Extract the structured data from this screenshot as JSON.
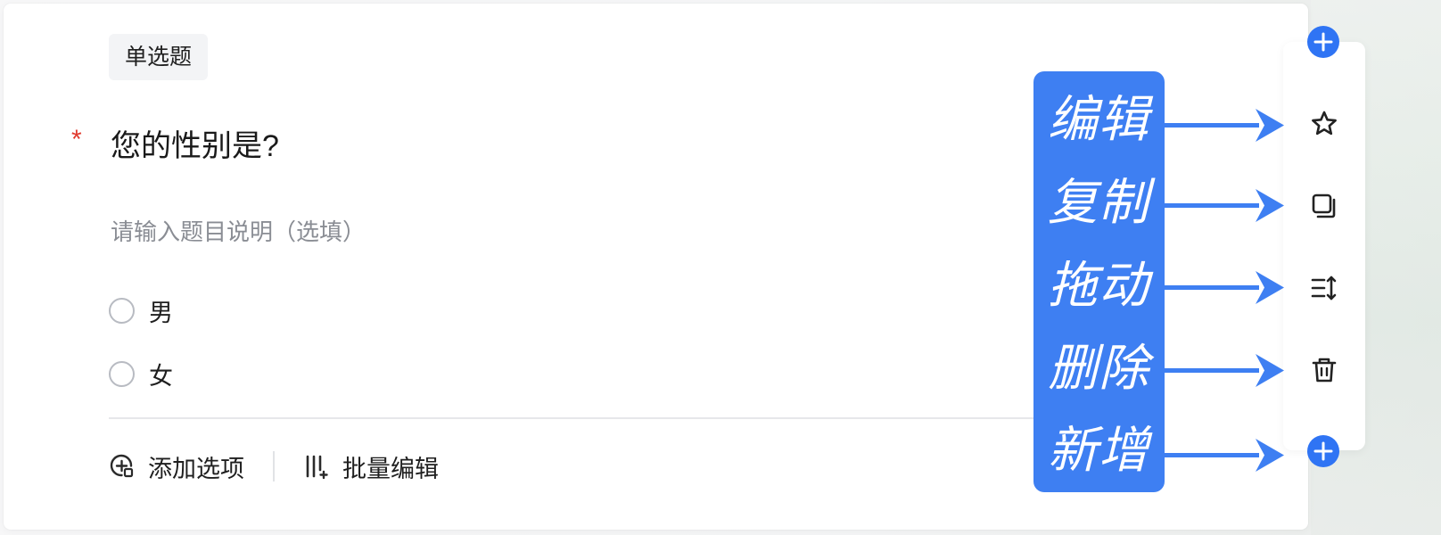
{
  "question": {
    "type_tag": "单选题",
    "required_mark": "*",
    "title": "您的性别是?",
    "description_placeholder": "请输入题目说明（选填）",
    "options": [
      {
        "label": "男"
      },
      {
        "label": "女"
      }
    ]
  },
  "footer": {
    "add_option_label": "添加选项",
    "batch_edit_label": "批量编辑"
  },
  "toolbar": {
    "buttons": [
      {
        "name": "add-top",
        "icon": "plus-circle-icon"
      },
      {
        "name": "edit",
        "icon": "star-icon"
      },
      {
        "name": "copy",
        "icon": "copy-icon"
      },
      {
        "name": "drag",
        "icon": "drag-sort-icon"
      },
      {
        "name": "delete",
        "icon": "trash-icon"
      },
      {
        "name": "add-bottom",
        "icon": "plus-circle-icon"
      }
    ]
  },
  "annotations": {
    "labels": [
      "编辑",
      "复制",
      "拖动",
      "删除",
      "新增"
    ]
  },
  "colors": {
    "accent_blue": "#2f74f4",
    "callout_blue": "#3e7ff2",
    "required_red": "#e03a2e",
    "muted_text": "#8a8d94"
  }
}
